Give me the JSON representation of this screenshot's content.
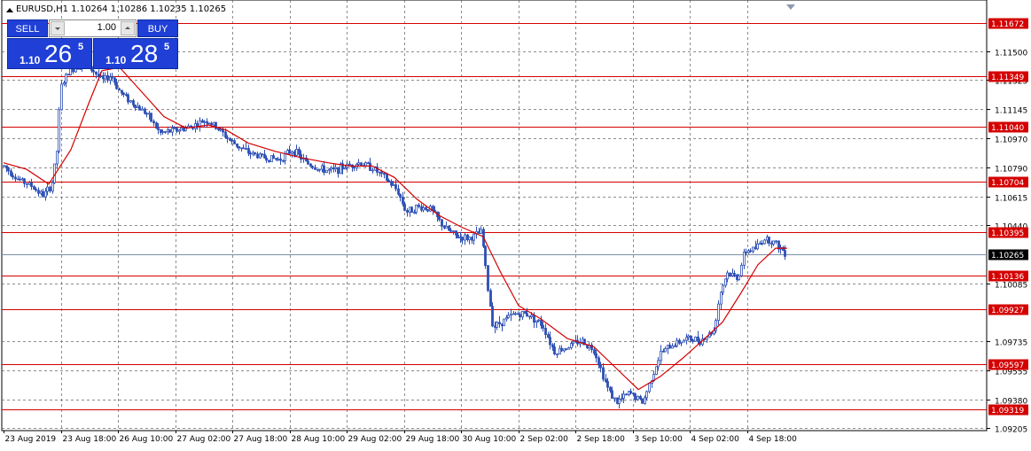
{
  "window": {
    "symbol_header": "EURUSD,H1  1.10264 1.10286 1.10235 1.10265"
  },
  "trade_panel": {
    "sell_label": "SELL",
    "buy_label": "BUY",
    "lot_size": "1.00",
    "sell_price_prefix": "1.10",
    "sell_price_main": "26",
    "sell_price_frac": "5",
    "buy_price_prefix": "1.10",
    "buy_price_main": "28",
    "buy_price_frac": "5"
  },
  "colors": {
    "background": "#ffffff",
    "candle": "#2c4fb5",
    "grid": "#5c5c5c",
    "level_line": "#d40000",
    "moving_average": "#d40000",
    "current_price_line": "#7a8ea8",
    "trade_button": "#1f3fd6"
  },
  "chart_data": {
    "type": "candlestick",
    "symbol": "EURUSD",
    "timeframe": "H1",
    "ohlc_header": {
      "open": 1.10264,
      "high": 1.10286,
      "low": 1.10235,
      "close": 1.10265
    },
    "current_price": "1.10265",
    "y_axis_labels": [
      "1.11500",
      "1.11325",
      "1.11145",
      "1.10970",
      "1.10790",
      "1.10615",
      "1.10440",
      "1.10085",
      "1.09735",
      "1.09555",
      "1.09380",
      "1.09205"
    ],
    "x_axis_labels": [
      "23 Aug 2019",
      "23 Aug 18:00",
      "26 Aug 10:00",
      "27 Aug 02:00",
      "27 Aug 18:00",
      "28 Aug 10:00",
      "29 Aug 02:00",
      "29 Aug 18:00",
      "30 Aug 10:00",
      "2 Sep 02:00",
      "2 Sep 18:00",
      "3 Sep 10:00",
      "4 Sep 02:00",
      "4 Sep 18:00"
    ],
    "horizontal_levels": [
      "1.11672",
      "1.11349",
      "1.11040",
      "1.10704",
      "1.10395",
      "1.10136",
      "1.09927",
      "1.09597",
      "1.09319"
    ],
    "ylim": [
      1.0919,
      1.1174
    ],
    "grid": true,
    "close_path": [
      {
        "x": 4,
        "y": 1.108
      },
      {
        "x": 20,
        "y": 1.1072
      },
      {
        "x": 35,
        "y": 1.1068
      },
      {
        "x": 48,
        "y": 1.1062
      },
      {
        "x": 58,
        "y": 1.1068
      },
      {
        "x": 64,
        "y": 1.109
      },
      {
        "x": 68,
        "y": 1.1128
      },
      {
        "x": 78,
        "y": 1.1138
      },
      {
        "x": 92,
        "y": 1.1142
      },
      {
        "x": 105,
        "y": 1.1138
      },
      {
        "x": 115,
        "y": 1.1132
      },
      {
        "x": 125,
        "y": 1.1135
      },
      {
        "x": 135,
        "y": 1.1125
      },
      {
        "x": 150,
        "y": 1.1118
      },
      {
        "x": 165,
        "y": 1.1112
      },
      {
        "x": 180,
        "y": 1.11
      },
      {
        "x": 200,
        "y": 1.1102
      },
      {
        "x": 215,
        "y": 1.1104
      },
      {
        "x": 232,
        "y": 1.1108
      },
      {
        "x": 245,
        "y": 1.1103
      },
      {
        "x": 260,
        "y": 1.1095
      },
      {
        "x": 280,
        "y": 1.1088
      },
      {
        "x": 300,
        "y": 1.1085
      },
      {
        "x": 315,
        "y": 1.1084
      },
      {
        "x": 330,
        "y": 1.109
      },
      {
        "x": 345,
        "y": 1.1082
      },
      {
        "x": 360,
        "y": 1.1078
      },
      {
        "x": 375,
        "y": 1.1077
      },
      {
        "x": 390,
        "y": 1.108
      },
      {
        "x": 405,
        "y": 1.1082
      },
      {
        "x": 420,
        "y": 1.1079
      },
      {
        "x": 435,
        "y": 1.1072
      },
      {
        "x": 448,
        "y": 1.1065
      },
      {
        "x": 458,
        "y": 1.1052
      },
      {
        "x": 470,
        "y": 1.1055
      },
      {
        "x": 485,
        "y": 1.1054
      },
      {
        "x": 500,
        "y": 1.1043
      },
      {
        "x": 515,
        "y": 1.1037
      },
      {
        "x": 530,
        "y": 1.1036
      },
      {
        "x": 543,
        "y": 1.104
      },
      {
        "x": 550,
        "y": 1.1005
      },
      {
        "x": 556,
        "y": 1.0982
      },
      {
        "x": 565,
        "y": 1.0985
      },
      {
        "x": 580,
        "y": 1.099
      },
      {
        "x": 595,
        "y": 1.099
      },
      {
        "x": 612,
        "y": 1.0983
      },
      {
        "x": 625,
        "y": 1.0967
      },
      {
        "x": 640,
        "y": 1.097
      },
      {
        "x": 655,
        "y": 1.0974
      },
      {
        "x": 670,
        "y": 1.0968
      },
      {
        "x": 685,
        "y": 1.0945
      },
      {
        "x": 695,
        "y": 1.0936
      },
      {
        "x": 710,
        "y": 1.0942
      },
      {
        "x": 725,
        "y": 1.0936
      },
      {
        "x": 735,
        "y": 1.0952
      },
      {
        "x": 745,
        "y": 1.0966
      },
      {
        "x": 760,
        "y": 1.0972
      },
      {
        "x": 775,
        "y": 1.0975
      },
      {
        "x": 790,
        "y": 1.0974
      },
      {
        "x": 805,
        "y": 1.098
      },
      {
        "x": 812,
        "y": 1.1003
      },
      {
        "x": 820,
        "y": 1.1015
      },
      {
        "x": 832,
        "y": 1.1012
      },
      {
        "x": 840,
        "y": 1.1028
      },
      {
        "x": 852,
        "y": 1.103
      },
      {
        "x": 862,
        "y": 1.1036
      },
      {
        "x": 872,
        "y": 1.1034
      },
      {
        "x": 880,
        "y": 1.103
      },
      {
        "x": 888,
        "y": 1.10265
      }
    ],
    "moving_average_path": [
      {
        "x": 4,
        "y": 1.1082
      },
      {
        "x": 30,
        "y": 1.1078
      },
      {
        "x": 55,
        "y": 1.1069
      },
      {
        "x": 80,
        "y": 1.109
      },
      {
        "x": 100,
        "y": 1.1118
      },
      {
        "x": 115,
        "y": 1.1138
      },
      {
        "x": 135,
        "y": 1.114
      },
      {
        "x": 160,
        "y": 1.1125
      },
      {
        "x": 185,
        "y": 1.111
      },
      {
        "x": 210,
        "y": 1.1103
      },
      {
        "x": 235,
        "y": 1.1105
      },
      {
        "x": 255,
        "y": 1.1102
      },
      {
        "x": 280,
        "y": 1.1094
      },
      {
        "x": 310,
        "y": 1.1089
      },
      {
        "x": 340,
        "y": 1.1085
      },
      {
        "x": 370,
        "y": 1.1082
      },
      {
        "x": 395,
        "y": 1.108
      },
      {
        "x": 420,
        "y": 1.108
      },
      {
        "x": 445,
        "y": 1.1073
      },
      {
        "x": 470,
        "y": 1.106
      },
      {
        "x": 495,
        "y": 1.105
      },
      {
        "x": 520,
        "y": 1.1043
      },
      {
        "x": 545,
        "y": 1.1037
      },
      {
        "x": 565,
        "y": 1.1015
      },
      {
        "x": 585,
        "y": 1.0995
      },
      {
        "x": 610,
        "y": 1.0987
      },
      {
        "x": 640,
        "y": 1.0975
      },
      {
        "x": 670,
        "y": 1.097
      },
      {
        "x": 695,
        "y": 1.0957
      },
      {
        "x": 720,
        "y": 1.0944
      },
      {
        "x": 745,
        "y": 1.0952
      },
      {
        "x": 770,
        "y": 1.0963
      },
      {
        "x": 795,
        "y": 1.0975
      },
      {
        "x": 815,
        "y": 1.0985
      },
      {
        "x": 835,
        "y": 1.1002
      },
      {
        "x": 855,
        "y": 1.102
      },
      {
        "x": 875,
        "y": 1.103
      },
      {
        "x": 888,
        "y": 1.103
      }
    ]
  }
}
